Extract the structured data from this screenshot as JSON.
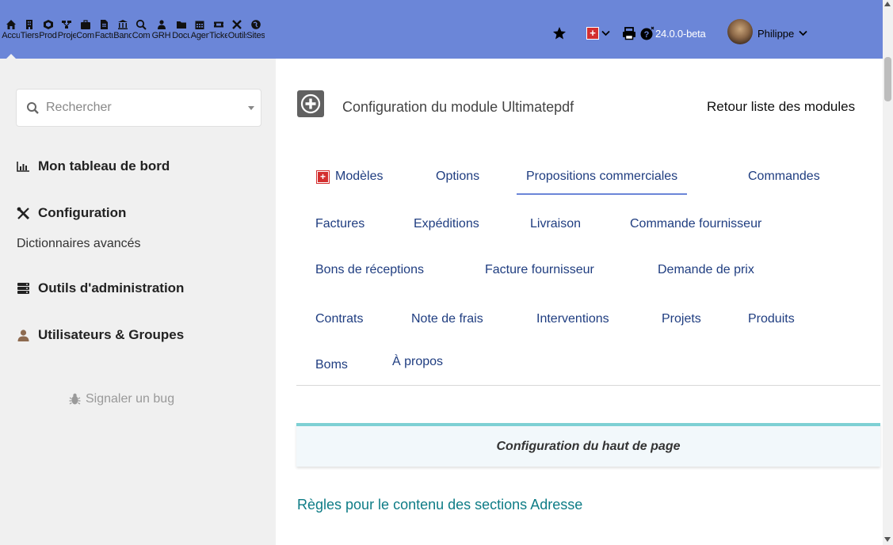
{
  "topbar": {
    "menu": [
      {
        "label": "Accueil",
        "icon": "home-icon"
      },
      {
        "label": "Tiers",
        "icon": "building-icon"
      },
      {
        "label": "Produits",
        "icon": "cube-icon"
      },
      {
        "label": "Projets",
        "icon": "project-icon"
      },
      {
        "label": "Commercial",
        "icon": "briefcase-icon"
      },
      {
        "label": "Facturation",
        "icon": "invoice-icon"
      },
      {
        "label": "Banque",
        "icon": "bank-icon"
      },
      {
        "label": "Compta",
        "icon": "search-dollar-icon"
      },
      {
        "label": "GRH",
        "icon": "users-icon"
      },
      {
        "label": "Documents",
        "icon": "folder-icon"
      },
      {
        "label": "Agenda",
        "icon": "calendar-icon"
      },
      {
        "label": "Tickets",
        "icon": "ticket-icon"
      },
      {
        "label": "Outils",
        "icon": "tools-icon"
      },
      {
        "label": "Sites",
        "icon": "globe-icon"
      }
    ],
    "version": "24.0.0-beta",
    "user_name": "Philippe",
    "colors": {
      "bar": "#6b86d8",
      "flag": "#d32f2f"
    }
  },
  "sidebar": {
    "search_placeholder": "Rechercher",
    "dashboard": "Mon tableau de bord",
    "configuration": "Configuration",
    "dictionaries": "Dictionnaires avancés",
    "admin_tools": "Outils d'administration",
    "users_groups": "Utilisateurs & Groupes",
    "report_bug": "Signaler un bug"
  },
  "main": {
    "title": "Configuration du module Ultimatepdf",
    "back_link": "Retour liste des modules",
    "tabs": [
      "Modèles",
      "Options",
      "Propositions commerciales",
      "Commandes",
      "Factures",
      "Expéditions",
      "Livraison",
      "Commande fournisseur",
      "Bons de réceptions",
      "Facture fournisseur",
      "Demande de prix",
      "Contrats",
      "Note de frais",
      "Interventions",
      "Projets",
      "Produits",
      "Boms",
      "À propos"
    ],
    "active_tab": "Propositions commerciales",
    "section_title": "Configuration du haut de page",
    "rules_link": "Règles pour le contenu des sections Adresse"
  }
}
